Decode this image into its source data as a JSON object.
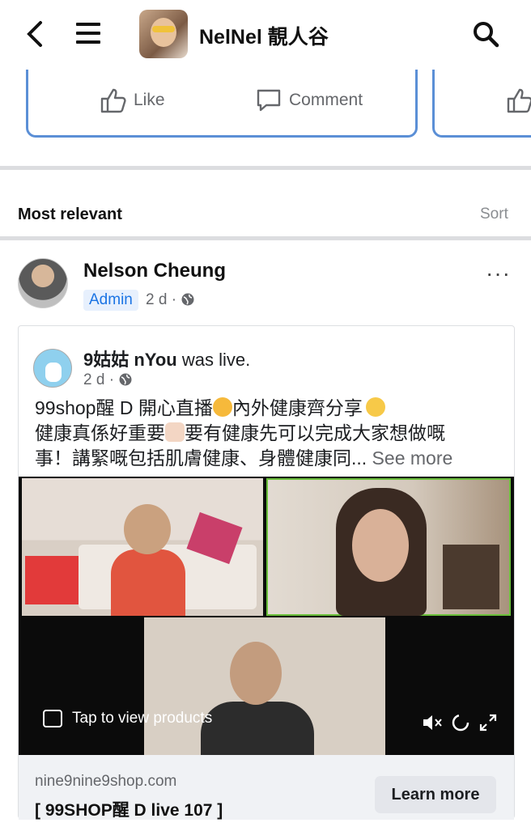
{
  "header": {
    "back_icon": "back-arrow-icon",
    "menu_icon": "hamburger-menu-icon",
    "page_name": "NelNel 靚人谷",
    "search_icon": "search-icon"
  },
  "post_actions": {
    "like": "Like",
    "comment": "Comment"
  },
  "comments": {
    "filter": "Most relevant",
    "sort": "Sort"
  },
  "comment": {
    "author": "Nelson Cheung",
    "badge": "Admin",
    "time": "2 d ·",
    "more": "···",
    "shared_post": {
      "author": "9姑姑 nYou",
      "action": " was live.",
      "time": "2 d ·",
      "text_line1": "99shop醒 D 開心直播",
      "text_line1b": "內外健康齊分享",
      "text_line2a": "健康真係好重要",
      "text_line2b": "要有健康先可以完成大家想做嘅",
      "text_line3": "事！講緊嘅包括肌膚健康、身體健康同...",
      "see_more": " See more",
      "video_overlay": "Tap to view products",
      "link_domain": "nine9nine9shop.com",
      "link_title": "[ 99SHOP醒 D live 107 ]",
      "cta": "Learn more"
    }
  },
  "colors": {
    "accent": "#1b74e4",
    "card_border": "#5b8fd6",
    "live_tile_border": "#6abf3a"
  }
}
